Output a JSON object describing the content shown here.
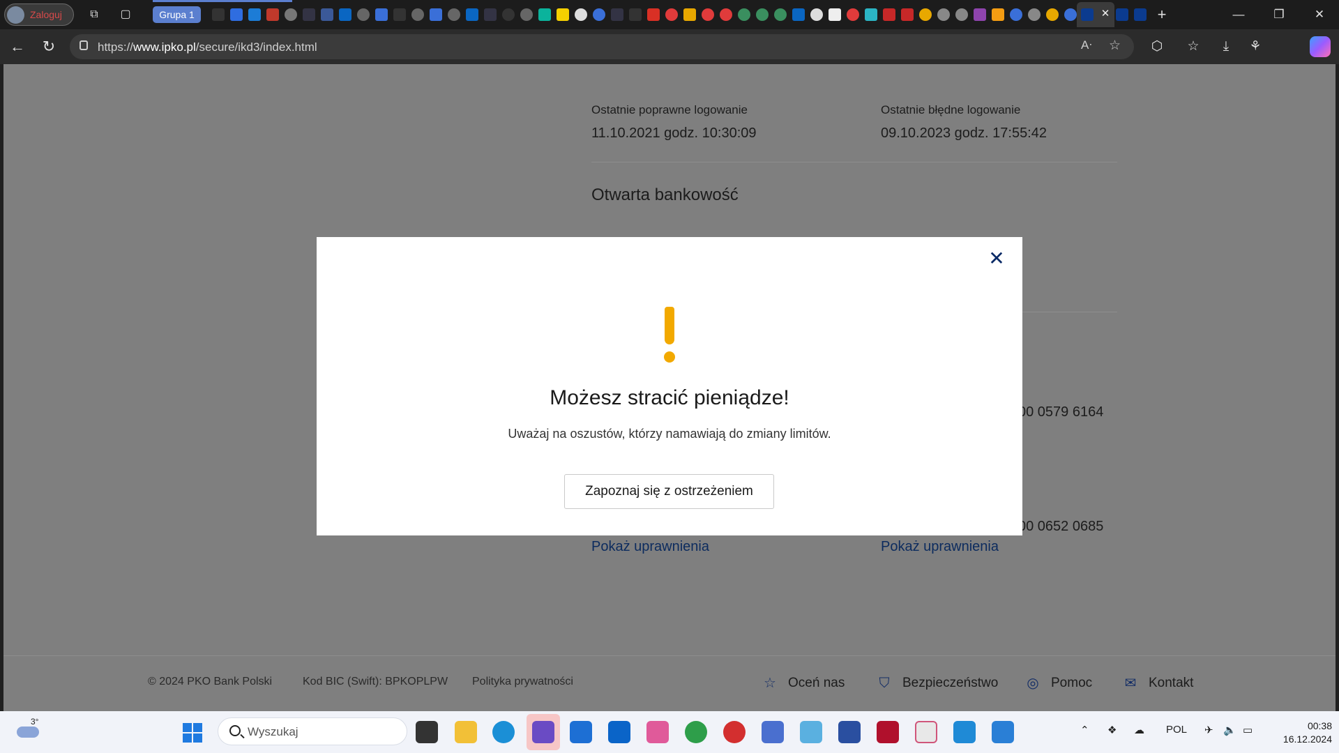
{
  "browser": {
    "profile_label": "Zaloguj",
    "tab_group_label": "Grupa 1",
    "url_prefix": "https://",
    "url_domain": "www.ipko.pl",
    "url_path": "/secure/ikd3/index.html"
  },
  "page": {
    "last_ok_login_label": "Ostatnie poprawne logowanie",
    "last_ok_login_value": "11.10.2021 godz. 10:30:09",
    "last_bad_login_label": "Ostatnie błędne logowanie",
    "last_bad_login_value": "09.10.2023 godz. 17:55:42",
    "open_banking_heading": "Otwarta bankowość",
    "partial_account_1": "00 0579 6164",
    "partial_account_2": "00 0652 0685",
    "show_permissions_left": "Pokaż uprawnienia",
    "show_permissions_right": "Pokaż uprawnienia"
  },
  "footer": {
    "copyright": "© 2024 PKO Bank Polski",
    "bic": "Kod BIC (Swift): BPKOPLPW",
    "privacy": "Polityka prywatności",
    "rate": "Oceń nas",
    "security": "Bezpieczeństwo",
    "help": "Pomoc",
    "contact": "Kontakt"
  },
  "modal": {
    "title": "Możesz stracić pieniądze!",
    "subtitle": "Uważaj na oszustów, którzy namawiają do zmiany limitów.",
    "button_label": "Zapoznaj się z ostrzeżeniem",
    "close_icon": "close-icon",
    "warning_icon": "exclamation-icon",
    "accent_color": "#f2a900"
  },
  "taskbar": {
    "temperature": "3°",
    "search_placeholder": "Wyszukaj",
    "language": "POL",
    "time": "00:38",
    "date": "16.12.2024"
  }
}
